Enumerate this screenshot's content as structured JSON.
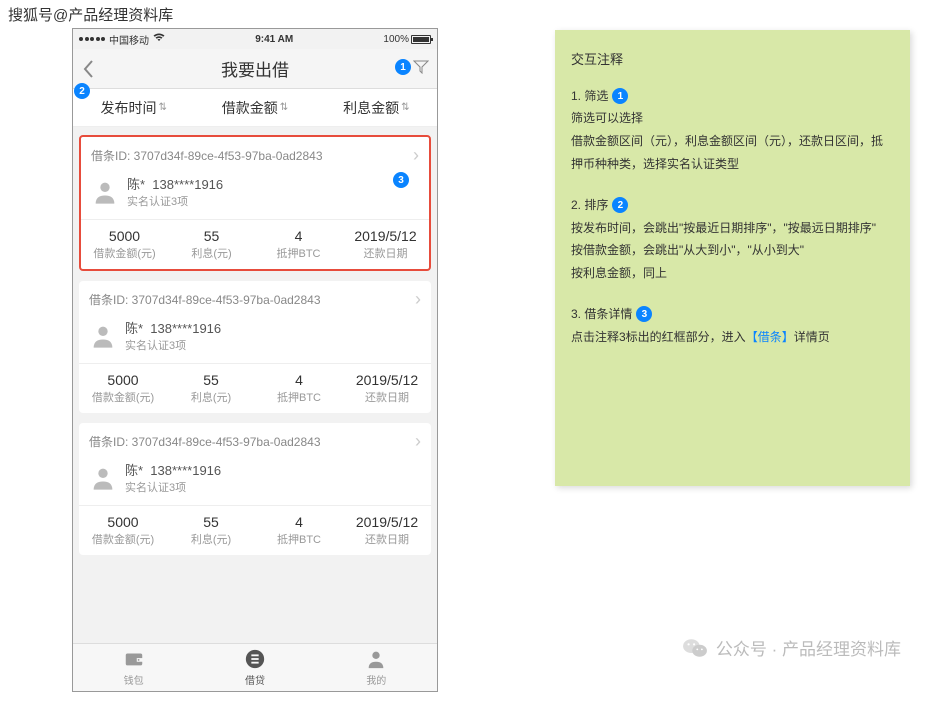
{
  "watermark": "搜狐号@产品经理资料库",
  "status": {
    "carrier": "中国移动",
    "time": "9:41 AM",
    "battery": "100%"
  },
  "nav": {
    "title": "我要出借"
  },
  "badges": {
    "b1": "1",
    "b2": "2",
    "b3": "3"
  },
  "sort": {
    "s1": "发布时间",
    "s2": "借款金额",
    "s3": "利息金额"
  },
  "card": {
    "id_label": "借条ID: 3707d34f-89ce-4f53-97ba-0ad2843",
    "name": "陈*",
    "phone": "138****1916",
    "auth": "实名认证3项",
    "stats": [
      {
        "val": "5000",
        "label": "借款金额(元)"
      },
      {
        "val": "55",
        "label": "利息(元)"
      },
      {
        "val": "4",
        "label": "抵押BTC"
      },
      {
        "val": "2019/5/12",
        "label": "还款日期"
      }
    ]
  },
  "tabs": {
    "t1": "钱包",
    "t2": "借贷",
    "t3": "我的"
  },
  "annotation": {
    "title": "交互注释",
    "s1_head": "1. 筛选",
    "s1_body": "筛选可以选择\n借款金额区间（元），利息金额区间（元），还款日区间，抵押币种种类，选择实名认证类型",
    "s2_head": "2. 排序",
    "s2_body": "按发布时间，会跳出\"按最近日期排序\"，\"按最远日期排序\"\n按借款金额，会跳出\"从大到小\"，\"从小到大\"\n按利息金额，同上",
    "s3_head": "3. 借条详情",
    "s3_body1": "点击注释3标出的红框部分，进入",
    "s3_link": "【借条】",
    "s3_body2": "详情页"
  },
  "footer": "公众号 · 产品经理资料库"
}
